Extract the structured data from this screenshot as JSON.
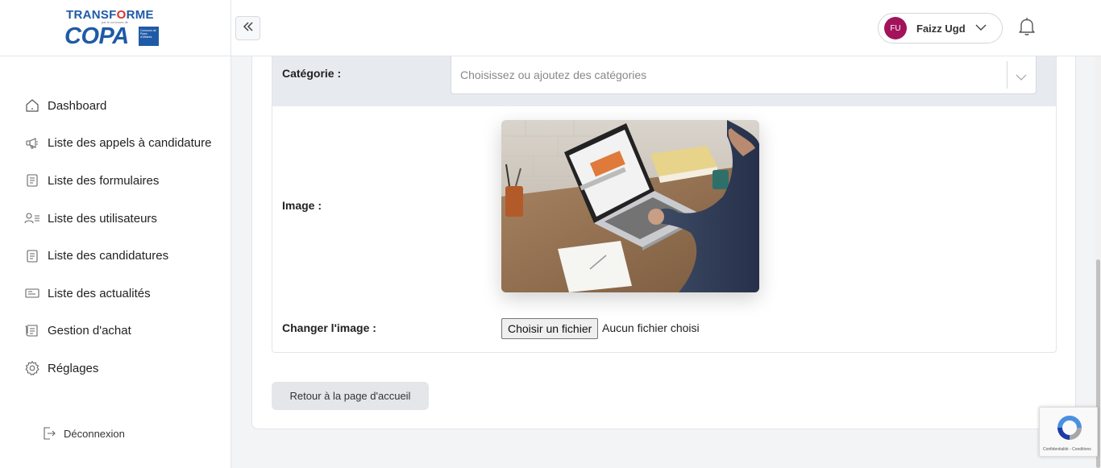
{
  "brand": {
    "logo_top": "TRANSF",
    "logo_top_o": "O",
    "logo_top_end": "RME",
    "logo_sub": "par le concours de",
    "logo_main": "COPA",
    "logo_badge": "Concours de Plans d'Affaires"
  },
  "sidebar": {
    "items": [
      {
        "label": "Dashboard",
        "icon": "home-icon"
      },
      {
        "label": "Liste des appels à candidature",
        "icon": "megaphone-icon"
      },
      {
        "label": "Liste des formulaires",
        "icon": "form-icon"
      },
      {
        "label": "Liste des utilisateurs",
        "icon": "users-icon"
      },
      {
        "label": "Liste des candidatures",
        "icon": "document-icon"
      },
      {
        "label": "Liste des actualités",
        "icon": "news-icon"
      },
      {
        "label": "Gestion d'achat",
        "icon": "receipt-icon"
      },
      {
        "label": "Réglages",
        "icon": "gear-icon"
      }
    ],
    "logout_label": "Déconnexion"
  },
  "topbar": {
    "user_initials": "FU",
    "user_name": "Faizz Ugd",
    "avatar_color": "#a3135c"
  },
  "form": {
    "category_label": "Catégorie :",
    "category_placeholder": "Choisissez ou ajoutez des catégories",
    "image_label": "Image :",
    "change_image_label": "Changer l'image :",
    "file_button": "Choisir un fichier",
    "file_status": "Aucun fichier choisi"
  },
  "actions": {
    "back_label": "Retour à la page d'accueil"
  },
  "recaptcha": {
    "footer": "Confidentialité - Conditions"
  }
}
